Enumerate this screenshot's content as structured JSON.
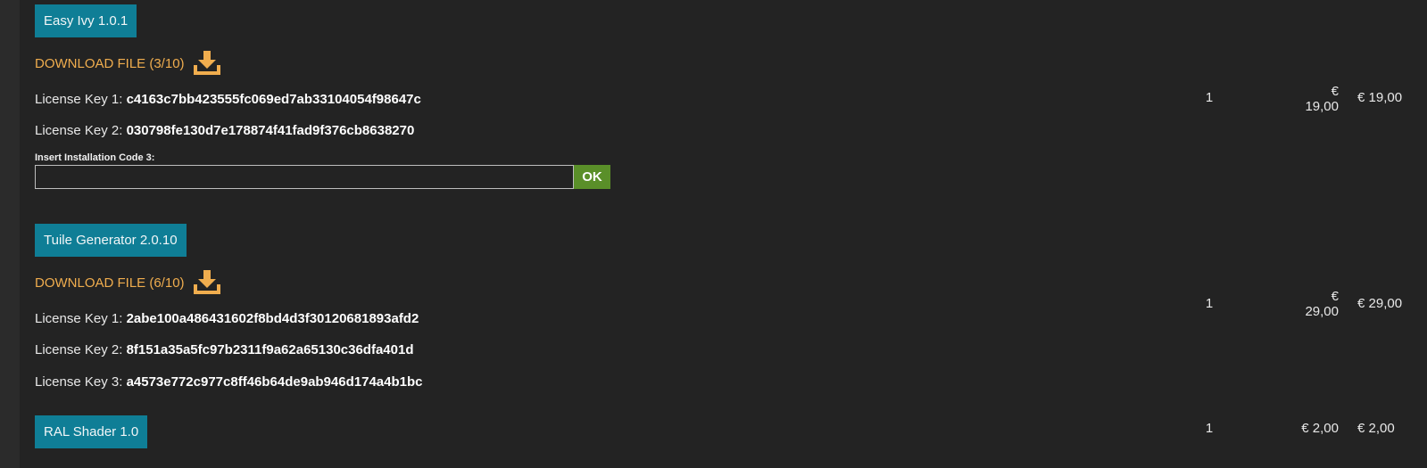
{
  "products": [
    {
      "name": "Easy Ivy 1.0.1",
      "download_label": "DOWNLOAD FILE (3/10)",
      "licenses": [
        {
          "label": "License Key 1: ",
          "key": "c4163c7bb423555fc069ed7ab33104054f98647c"
        },
        {
          "label": "License Key 2: ",
          "key": "030798fe130d7e178874f41fad9f376cb8638270"
        }
      ],
      "install_label": "Insert Installation Code 3:",
      "install_value": "",
      "ok_label": "OK",
      "quantity": "1",
      "price_currency": "€",
      "price_amount": "19,00",
      "total": "€ 19,00"
    },
    {
      "name": "Tuile Generator 2.0.10",
      "download_label": "DOWNLOAD FILE (6/10)",
      "licenses": [
        {
          "label": "License Key 1: ",
          "key": "2abe100a486431602f8bd4d3f30120681893afd2"
        },
        {
          "label": "License Key 2: ",
          "key": "8f151a35a5fc97b2311f9a62a65130c36dfa401d"
        },
        {
          "label": "License Key 3: ",
          "key": "a4573e772c977c8ff46b64de9ab946d174a4b1bc"
        }
      ],
      "quantity": "1",
      "price_currency": "€",
      "price_amount": "29,00",
      "total": "€ 29,00"
    },
    {
      "name": "RAL Shader 1.0",
      "quantity": "1",
      "price": "€ 2,00",
      "total": "€ 2,00"
    }
  ],
  "icons": {
    "download": "download-tray-icon"
  },
  "colors": {
    "background": "#232323",
    "product_button": "#0f7e96",
    "download_link": "#f0ad4e",
    "ok_button": "#5a8f29"
  }
}
